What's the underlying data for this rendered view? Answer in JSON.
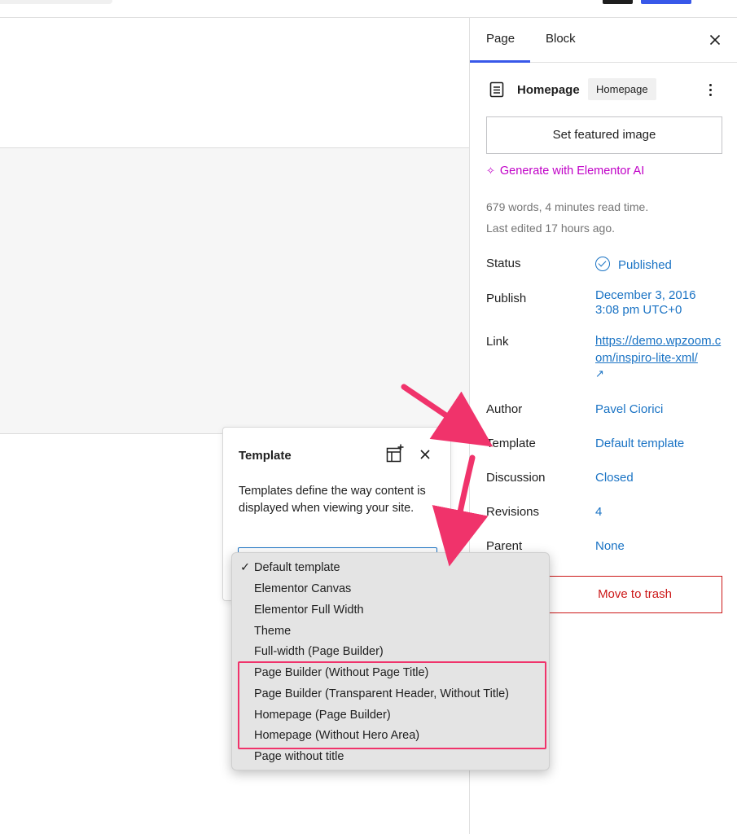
{
  "sidebar": {
    "tabs": [
      {
        "label": "Page"
      },
      {
        "label": "Block"
      }
    ],
    "document": {
      "title": "Homepage",
      "badge": "Homepage"
    },
    "featured_image_label": "Set featured image",
    "ai_link": {
      "sparkle": "✧",
      "label": "Generate with Elementor AI"
    },
    "meta": {
      "words": "679 words, 4 minutes read time.",
      "edited": "Last edited 17 hours ago."
    },
    "rows": {
      "status": {
        "label": "Status",
        "value": "Published"
      },
      "publish": {
        "label": "Publish",
        "value_line1": "December 3, 2016",
        "value_line2": "3:08 pm UTC+0"
      },
      "link": {
        "label": "Link",
        "value": "https://demo.wpzoom.com/inspiro-lite-xml/",
        "ext": "↗"
      },
      "author": {
        "label": "Author",
        "value": "Pavel Ciorici"
      },
      "template": {
        "label": "Template",
        "value": "Default template"
      },
      "discussion": {
        "label": "Discussion",
        "value": "Closed"
      },
      "revisions": {
        "label": "Revisions",
        "value": "4"
      },
      "parent": {
        "label": "Parent",
        "value": "None"
      }
    },
    "trash_label": "Move to trash"
  },
  "popover": {
    "title": "Template",
    "description": "Templates define the way content is displayed when viewing your site."
  },
  "dropdown": {
    "check": "✓",
    "options": [
      "Default template",
      "Elementor Canvas",
      "Elementor Full Width",
      "Theme",
      "Full-width (Page Builder)",
      "Page Builder (Without Page Title)",
      "Page Builder (Transparent Header, Without Title)",
      "Homepage (Page Builder)",
      "Homepage (Without Hero Area)",
      "Page without title"
    ],
    "selected_index": 0
  },
  "colors": {
    "accent": "#3858e9",
    "link": "#1a73c4",
    "ai": "#c000c7",
    "danger": "#cc1818",
    "annotation": "#f0336b"
  },
  "icons": {
    "close": "close-icon",
    "document": "document-icon",
    "kebab": "more-vertical-icon",
    "template_add": "template-add-icon",
    "status": "check-circle-icon",
    "external": "external-link-icon"
  }
}
